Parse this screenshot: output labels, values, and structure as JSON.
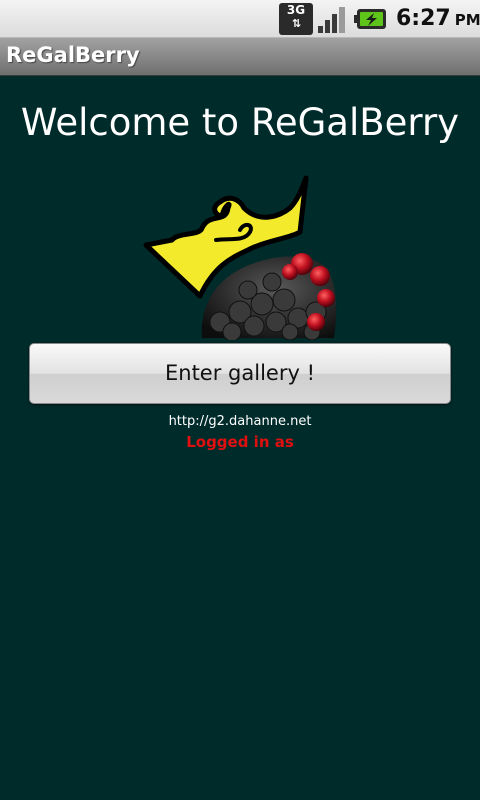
{
  "status_bar": {
    "network_type": "3G",
    "network_arrows": "⇅",
    "signal_icon": "signal-strength-icon",
    "battery_icon": "battery-charging-icon",
    "time": "6:27",
    "ampm": "PM"
  },
  "app": {
    "title": "ReGalBerry"
  },
  "main": {
    "welcome_text": "Welcome to ReGalBerry",
    "logo_icon": "crowned-berry-logo",
    "enter_button_label": "Enter gallery !",
    "server_url": "http://g2.dahanne.net",
    "login_status": "Logged in as"
  },
  "colors": {
    "background": "#002b2b",
    "login_status": "#e01010",
    "crown": "#f2ea2a"
  }
}
